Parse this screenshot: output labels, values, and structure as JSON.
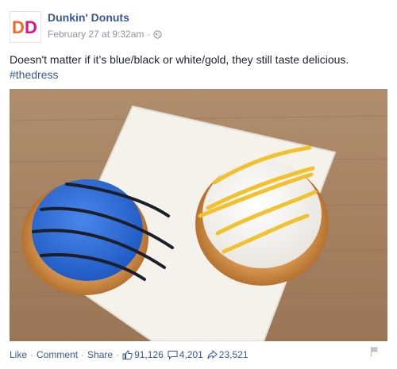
{
  "post": {
    "page_name": "Dunkin' Donuts",
    "timestamp": "February 27 at 9:32am",
    "audience_icon": "globe-icon",
    "text": "Doesn't matter if it’s blue/black or white/gold, they still taste delicious.",
    "hashtag": "#thedress",
    "logo_letters": "DD",
    "photo": {
      "description_icon": "photo",
      "colors": {
        "blue_glaze": "#2f6fd9",
        "white_glaze": "#f7f7f5",
        "gold_drizzle": "#f2c12e",
        "table_wood": "#a98564",
        "plate": "#f4f1ea"
      }
    }
  },
  "actions": {
    "like": "Like",
    "comment": "Comment",
    "share": "Share",
    "likes_count": "91,126",
    "comments_count": "4,201",
    "shares_count": "23,521"
  },
  "colors": {
    "link": "#365899",
    "meta": "#90949c",
    "text": "#1d2129",
    "logo_orange": "#f26a21",
    "logo_pink": "#e11383"
  }
}
